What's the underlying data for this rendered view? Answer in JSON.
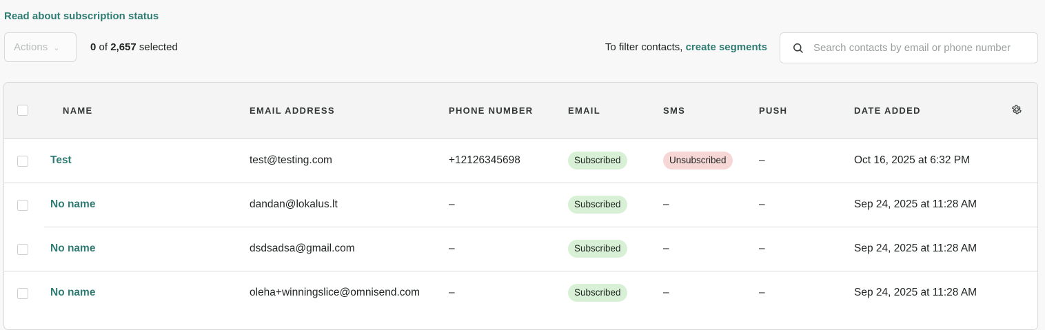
{
  "header": {
    "read_link": "Read about subscription status",
    "actions_label": "Actions",
    "selected_count": "0",
    "selected_of": " of ",
    "total": "2,657",
    "selected_suffix": " selected",
    "filter_prefix": "To filter contacts, ",
    "filter_link": "create segments",
    "search_placeholder": "Search contacts by email or phone number"
  },
  "columns": {
    "name": "NAME",
    "email_address": "EMAIL ADDRESS",
    "phone": "PHONE NUMBER",
    "email": "EMAIL",
    "sms": "SMS",
    "push": "PUSH",
    "date_added": "DATE ADDED"
  },
  "rows": [
    {
      "name": "Test",
      "email_address": "test@testing.com",
      "phone": "+12126345698",
      "email": "Subscribed",
      "sms": "Unsubscribed",
      "push": "–",
      "date": "Oct 16, 2025 at 6:32 PM"
    },
    {
      "name": "No name",
      "email_address": "dandan@lokalus.lt",
      "phone": "–",
      "email": "Subscribed",
      "sms": "–",
      "push": "–",
      "date": "Sep 24, 2025 at 11:28 AM"
    },
    {
      "name": "No name",
      "email_address": "dsdsadsa@gmail.com",
      "phone": "–",
      "email": "Subscribed",
      "sms": "–",
      "push": "–",
      "date": "Sep 24, 2025 at 11:28 AM"
    },
    {
      "name": "No name",
      "email_address": "oleha+winningslice@omnisend.com",
      "phone": "–",
      "email": "Subscribed",
      "sms": "–",
      "push": "–",
      "date": "Sep 24, 2025 at 11:28 AM"
    }
  ],
  "colors": {
    "accent": "#2f7c73",
    "subscribed_bg": "#d8f1d6",
    "unsubscribed_bg": "#f7d6d6"
  },
  "icons": {
    "search": "search-icon",
    "settings": "gear-icon",
    "dropdown": "chevron-down-icon"
  }
}
